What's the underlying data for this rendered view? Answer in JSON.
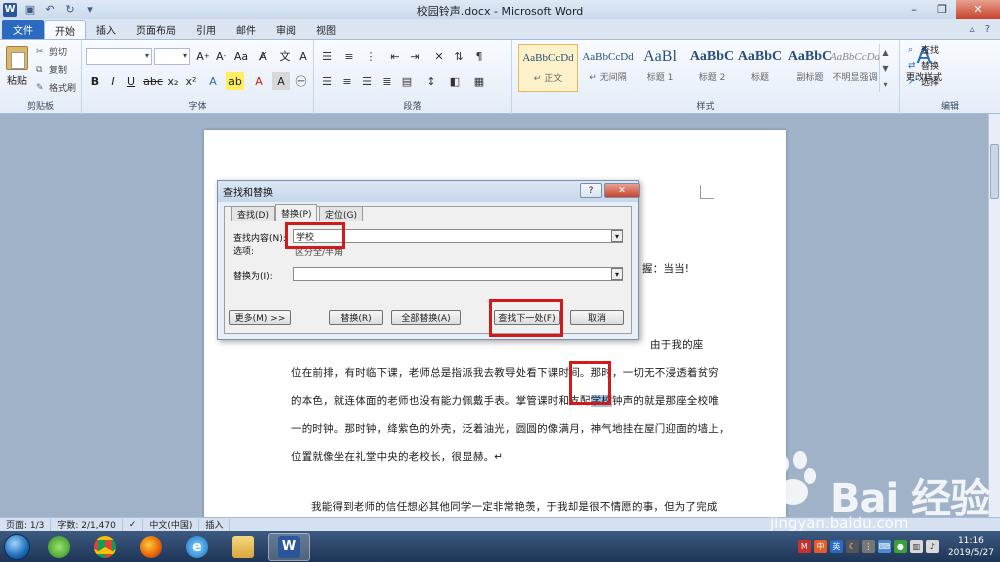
{
  "window": {
    "title": "校园铃声.docx - Microsoft Word"
  },
  "ribbon_tabs": [
    "文件",
    "开始",
    "插入",
    "页面布局",
    "引用",
    "邮件",
    "审阅",
    "视图"
  ],
  "clipboard": {
    "paste": "粘贴",
    "cut": "剪切",
    "copy": "复制",
    "format_painter": "格式刷",
    "label": "剪贴板"
  },
  "font_group": {
    "label": "字体"
  },
  "paragraph_group": {
    "label": "段落"
  },
  "styles_group": {
    "label": "样式",
    "styles": [
      {
        "sample": "AaBbCcDd",
        "name": "↵ 正文"
      },
      {
        "sample": "AaBbCcDd",
        "name": "↵ 无间隔"
      },
      {
        "sample": "AaBl",
        "name": "标题 1"
      },
      {
        "sample": "AaBbC",
        "name": "标题 2"
      },
      {
        "sample": "AaBbC",
        "name": "标题"
      },
      {
        "sample": "AaBbC",
        "name": "副标题"
      },
      {
        "sample": "AaBbCcDd",
        "name": "不明显强调"
      }
    ],
    "change_styles": "更改样式"
  },
  "editing_group": {
    "label": "编辑",
    "find": "查找",
    "replace": "替换",
    "select": "选择"
  },
  "document": {
    "lines": [
      "握：当当!",
      "由于我的座",
      "位在前排，有时临下课，老师总是指派我去教导处看下课时间。那时，一切无不浸透着贫穷",
      "的本色，就连体面的老师也没有能力佩戴手表。掌管课时和支配学校钟声的就是那座全校唯",
      "一的时钟。那时钟，绛紫色的外壳，泛着油光，圆圆的像满月，神气地挂在屋门迎面的墙上，",
      "位置就像坐在礼堂中央的老校长，很显赫。↵",
      "我能得到老师的信任想必其他同学一定非常艳羡，于我却是很不情愿的事，但为了完成"
    ],
    "line4_pre": "的本色，就连体面的老师也没有能力佩戴手表。掌管课时和支配",
    "line4_hl": "学校",
    "line4_post": "钟声的就是那座全校唯"
  },
  "dialog": {
    "title": "查找和替换",
    "help": "?",
    "tabs": [
      "查找(D)",
      "替换(P)",
      "定位(G)"
    ],
    "find_label": "查找内容(N):",
    "find_value": "学校",
    "options_label": "选项:",
    "options_value": "区分全/半角",
    "replace_label": "替换为(I):",
    "replace_value": "",
    "buttons": {
      "more": "更多(M) >>",
      "replace": "替换(R)",
      "replace_all": "全部替换(A)",
      "find_next": "查找下一处(F)",
      "cancel": "取消"
    }
  },
  "statusbar": {
    "page": "页面: 1/3",
    "words": "字数: 2/1,470",
    "language": "中文(中国)",
    "mode": "插入"
  },
  "taskbar": {
    "time": "11:16",
    "date": "2019/5/27",
    "ime": "英"
  },
  "watermark": {
    "brand": "Bai 经验",
    "url": "jingyan.baidu.com"
  },
  "colors": {
    "file_tab": "#2a6ac0",
    "highlight_box": "#d11a1a",
    "selection": "#9dc3ea"
  }
}
